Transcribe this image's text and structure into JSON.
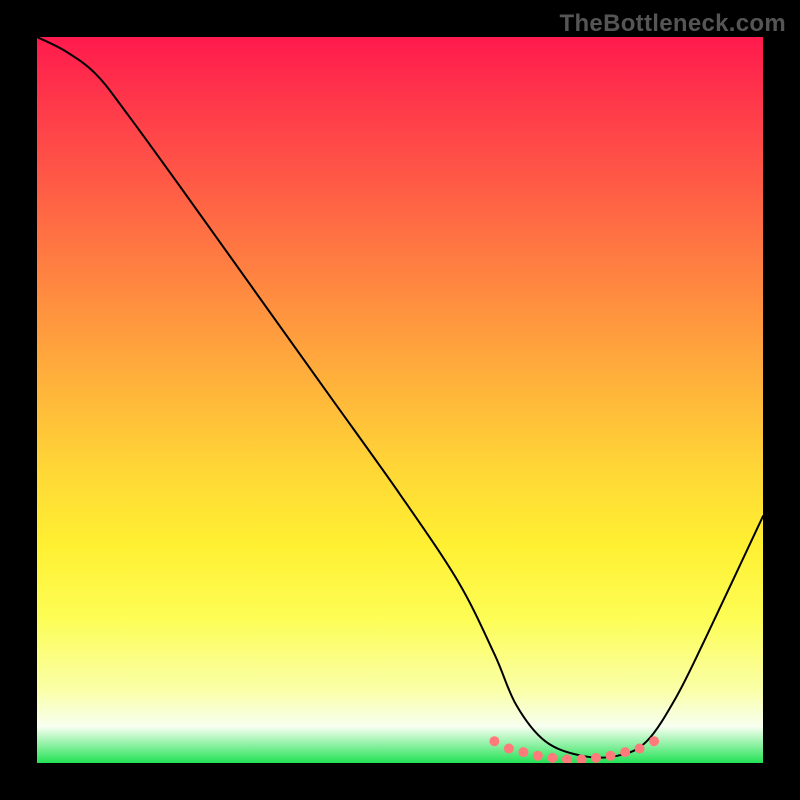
{
  "watermark": "TheBottleneck.com",
  "chart_data": {
    "type": "line",
    "title": "",
    "xlabel": "",
    "ylabel": "",
    "xlim": [
      0,
      100
    ],
    "ylim": [
      0,
      100
    ],
    "grid": false,
    "legend": false,
    "background_gradient": {
      "top": "#ff1a4d",
      "middle": "#ffd836",
      "bottom": "#22e255",
      "meaning": "red-high to green-low bottleneck scale"
    },
    "series": [
      {
        "name": "bottleneck-curve",
        "color": "#000000",
        "stroke_width": 2,
        "x": [
          0,
          4,
          8,
          12,
          20,
          30,
          40,
          50,
          58,
          63,
          66,
          70,
          75,
          80,
          84,
          88,
          92,
          100
        ],
        "values": [
          100,
          98,
          95,
          90,
          79,
          65,
          51,
          37,
          25,
          15,
          8,
          3,
          1,
          1,
          3,
          9,
          17,
          34
        ]
      },
      {
        "name": "optimal-zone-markers",
        "color": "#ff7a7a",
        "marker": "dot",
        "marker_size": 5,
        "x": [
          63,
          65,
          67,
          69,
          71,
          73,
          75,
          77,
          79,
          81,
          83,
          85
        ],
        "values": [
          3,
          2,
          1.5,
          1,
          0.7,
          0.5,
          0.5,
          0.7,
          1,
          1.5,
          2,
          3
        ]
      }
    ],
    "annotations": []
  }
}
